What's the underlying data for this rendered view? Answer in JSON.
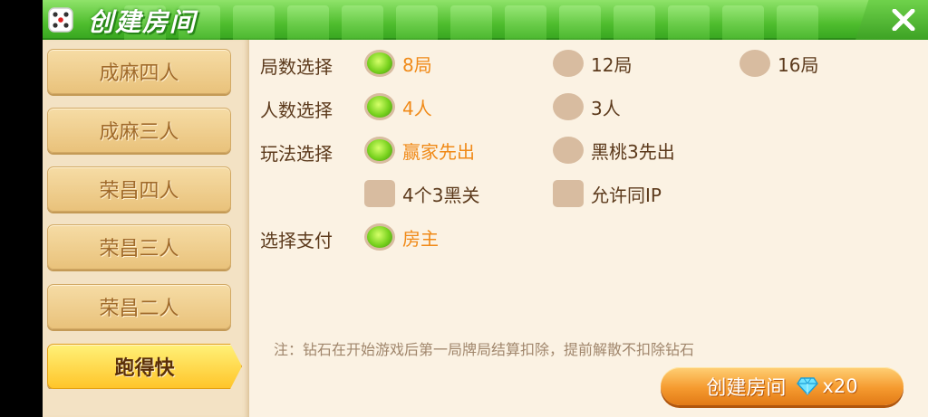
{
  "header": {
    "title": "创建房间"
  },
  "sidebar": {
    "tabs": [
      {
        "label": "成麻四人",
        "active": false
      },
      {
        "label": "成麻三人",
        "active": false
      },
      {
        "label": "荣昌四人",
        "active": false
      },
      {
        "label": "荣昌三人",
        "active": false
      },
      {
        "label": "荣昌二人",
        "active": false
      },
      {
        "label": "跑得快",
        "active": true
      }
    ]
  },
  "rows": {
    "rounds": {
      "label": "局数选择",
      "options": [
        "8局",
        "12局",
        "16局"
      ],
      "selected": "8局"
    },
    "players": {
      "label": "人数选择",
      "options": [
        "4人",
        "3人"
      ],
      "selected": "4人"
    },
    "play": {
      "label": "玩法选择",
      "options": [
        "赢家先出",
        "黑桃3先出"
      ],
      "selected": "赢家先出"
    },
    "extras": {
      "options": [
        "4个3黑关",
        "允许同IP"
      ],
      "checked": []
    },
    "payment": {
      "label": "选择支付",
      "options": [
        "房主"
      ],
      "selected": "房主"
    }
  },
  "note": "注：钻石在开始游戏后第一局牌局结算扣除，提前解散不扣除钻石",
  "create_button": {
    "label": "创建房间",
    "cost": "x20"
  },
  "colors": {
    "selected_text": "#f08a18",
    "label_text": "#5c3a1c",
    "header_green": "#4fbd2e"
  }
}
